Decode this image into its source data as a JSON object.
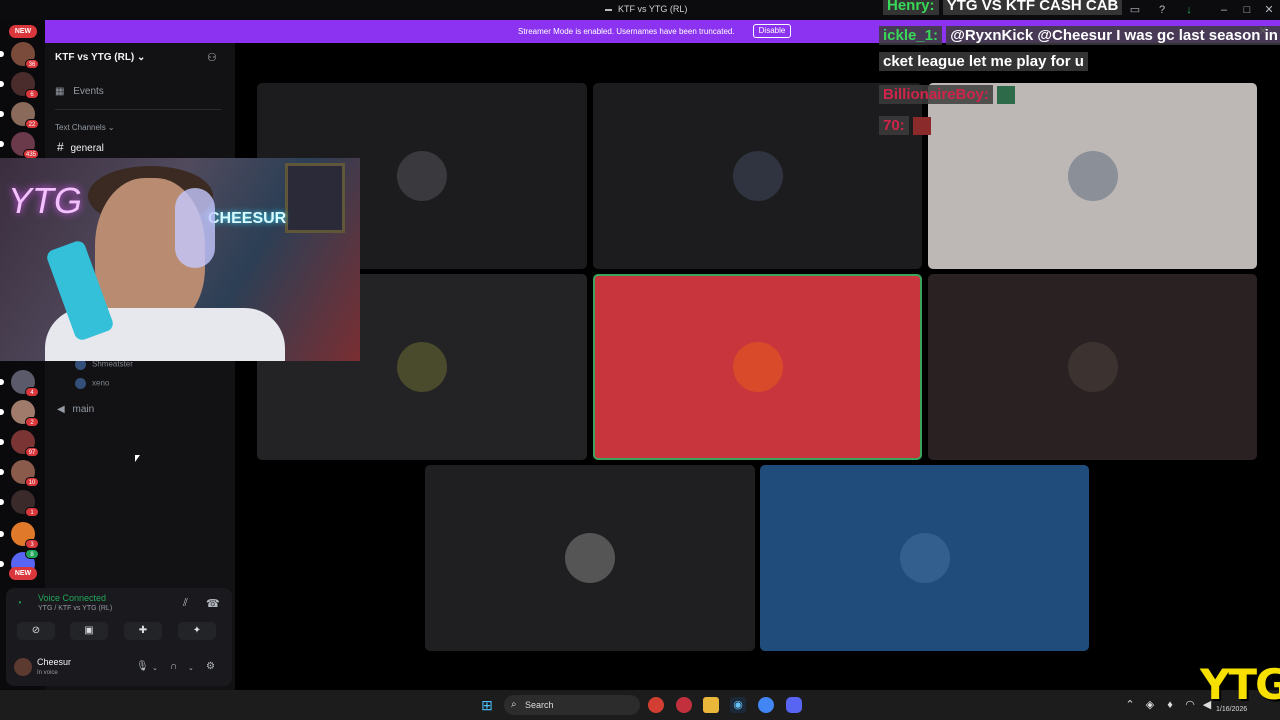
{
  "window": {
    "title": "KTF vs YTG (RL)"
  },
  "banner": {
    "text": "Streamer Mode is enabled. Usernames have been truncated.",
    "disable_label": "Disable",
    "close_glyph": "✕",
    "color": "#8b33f0"
  },
  "rail": {
    "new_label_top": "NEW",
    "new_label_bottom": "NEW",
    "badges": [
      "36",
      "6",
      "22",
      "435",
      "4",
      "2",
      "97",
      "10",
      "1",
      "3",
      "8"
    ]
  },
  "sidebar": {
    "server_name": "KTF vs YTG (RL)",
    "server_chevron": "⌄",
    "events_label": "Events",
    "text_channels_label": "Text Channels",
    "channel_general": "general",
    "voice_users": [
      "Shmeatster",
      "xeno"
    ],
    "channel_main": "main"
  },
  "voice_panel": {
    "status": "Voice Connected",
    "channel": "YTG / KTF vs YTG (RL)",
    "username": "Cheesur",
    "user_status": "In voice"
  },
  "webcam": {
    "neon_text": "YTG",
    "sign_text": "CHEESUR"
  },
  "chat": [
    {
      "user": "Henry:",
      "user_color": "#37d957",
      "message": "YTG VS KTF CASH CAB"
    },
    {
      "user": "ickle_1:",
      "user_color": "#37d957",
      "message": "@RyxnKick @Cheesur I was gc last season in"
    },
    {
      "user": "",
      "user_color": "#ffffff",
      "message": "cket league let me play for u"
    },
    {
      "user": "BillionaireBoy:",
      "user_color": "#d0244b",
      "message": ""
    },
    {
      "user": "70:",
      "user_color": "#d0244b",
      "message": ""
    }
  ],
  "tiles": [
    {
      "bg": "#1c1c1e",
      "pfp": "#3a3a3e"
    },
    {
      "bg": "#1c1c1e",
      "pfp": "#2f3440"
    },
    {
      "bg": "#bdb8b5",
      "pfp": "#8b8f98"
    },
    {
      "bg": "#232325",
      "pfp": "#4a4a2c"
    },
    {
      "bg": "#c9353c",
      "pfp": "#d84a2a"
    },
    {
      "bg": "#2a2222",
      "pfp": "#3c3230"
    },
    {
      "bg": "#1f1f21",
      "pfp": "#555555"
    },
    {
      "bg": "#204c7c",
      "pfp": "#325f8e"
    }
  ],
  "taskbar": {
    "search_label": "Search",
    "date": "1/16/2026"
  },
  "overlay_logo": "YTG"
}
